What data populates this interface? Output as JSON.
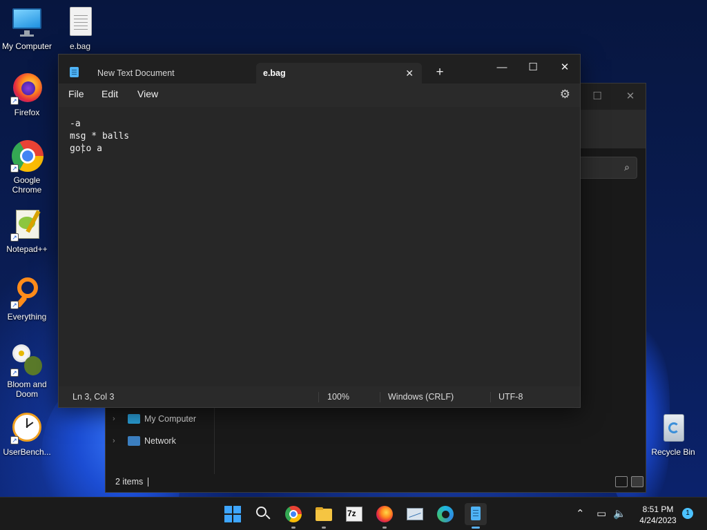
{
  "desktop": {
    "icons": [
      {
        "label": "My Computer"
      },
      {
        "label": "e.bag"
      },
      {
        "label": "Firefox"
      },
      {
        "label": "Google Chrome"
      },
      {
        "label": "Notepad++"
      },
      {
        "label": "Everything"
      },
      {
        "label": "Bloom and Doom"
      },
      {
        "label": "UserBench..."
      },
      {
        "label": "Recycle Bin"
      }
    ]
  },
  "explorer": {
    "nav_items": [
      {
        "label": "My Computer"
      },
      {
        "label": "Network"
      }
    ],
    "status": {
      "item_count": "2 items"
    }
  },
  "notepad": {
    "tabs": [
      {
        "label": "New Text Document"
      },
      {
        "label": "e.bag"
      }
    ],
    "window_controls": {
      "minimize": "—",
      "maximize": "☐",
      "close": "✕"
    },
    "menu": [
      {
        "label": "File"
      },
      {
        "label": "Edit"
      },
      {
        "label": "View"
      }
    ],
    "lines": [
      "-a",
      "msg * balls",
      "goto a"
    ],
    "status": {
      "position": "Ln 3, Col 3",
      "zoom": "100%",
      "line_ending": "Windows (CRLF)",
      "encoding": "UTF-8"
    }
  },
  "taskbar": {
    "apps": [
      "start-icon",
      "search-icon",
      "chrome-icon",
      "file-explorer-icon",
      "7zip-icon",
      "firefox-icon",
      "task-manager-icon",
      "edge-icon",
      "notepad-icon"
    ],
    "seven_zip_label": "7z",
    "clock": {
      "time": "8:51 PM",
      "date": "4/24/2023"
    },
    "notification_count": "1"
  },
  "colors": {
    "accent": "#4cc2ff",
    "notepad_bg": "#272727",
    "titlebar_bg": "#202020"
  }
}
